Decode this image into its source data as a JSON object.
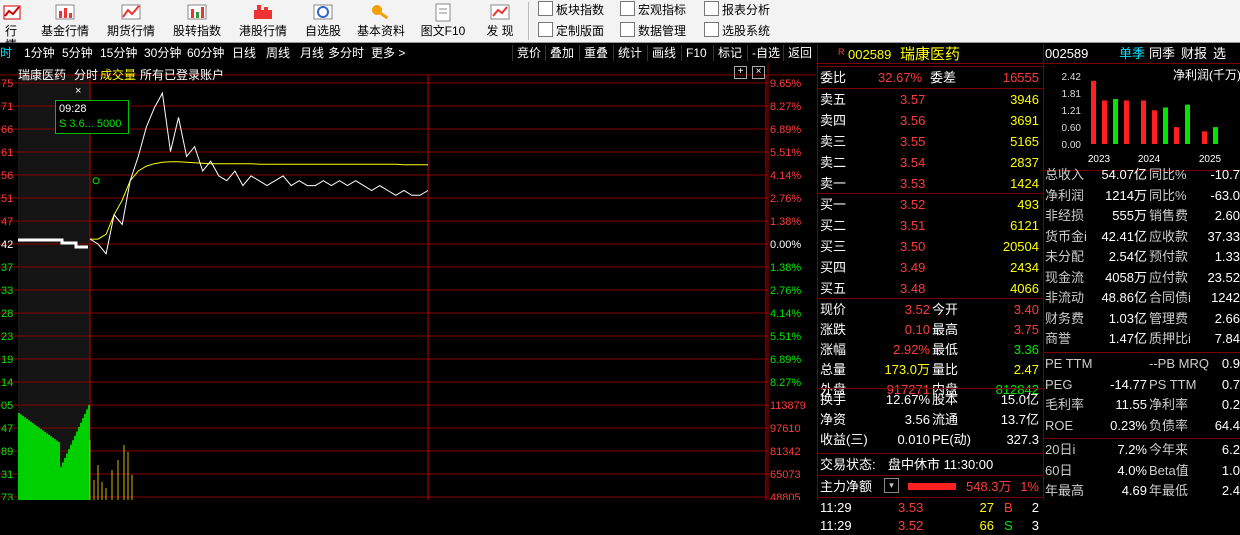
{
  "toolbar": {
    "buttons": [
      {
        "label": "行情",
        "icon": "quote-icon"
      },
      {
        "label": "基金行情",
        "icon": "fund-icon"
      },
      {
        "label": "期货行情",
        "icon": "futures-icon"
      },
      {
        "label": "股转指数",
        "icon": "index-icon"
      },
      {
        "label": "港股行情",
        "icon": "hk-stock-icon"
      },
      {
        "label": "自选股",
        "icon": "watchlist-icon"
      },
      {
        "label": "基本资料",
        "icon": "key-icon"
      },
      {
        "label": "图文F10",
        "icon": "document-icon"
      },
      {
        "label": "发 现",
        "icon": "discover-icon"
      }
    ],
    "small_buttons": [
      "板块指数",
      "宏观指标",
      "报表分析",
      "定制版面",
      "数据管理",
      "选股系统"
    ]
  },
  "periods": {
    "items": [
      "时",
      "1分钟",
      "5分钟",
      "15分钟",
      "30分钟",
      "60分钟",
      "日线",
      "周线",
      "月线",
      "多分时",
      "更多 >"
    ],
    "right_items": [
      "竞价",
      "叠加",
      "重叠",
      "统计",
      "画线",
      "F10",
      "标记",
      "-自选",
      "返回"
    ]
  },
  "chart": {
    "header_name": "瑞康医药",
    "header_mode": "分时",
    "header_volume": "成交量",
    "header_account": "所有已登录账户",
    "tooltip_time": "09:28",
    "tooltip_value": "S 3.6... 5000",
    "left_ticks": [
      "75",
      "71",
      "66",
      "61",
      "56",
      "51",
      "47",
      "42",
      "37",
      "33",
      "28",
      "23",
      "19",
      "14",
      "05",
      "47",
      "89",
      "31",
      "73"
    ],
    "pct_ticks": [
      "9.65%",
      "8.27%",
      "6.89%",
      "5.51%",
      "4.14%",
      "2.76%",
      "1.38%",
      "0.00%",
      "1.38%",
      "2.76%",
      "4.14%",
      "5.51%",
      "6.89%",
      "8.27%"
    ],
    "vol_ticks": [
      "113879",
      "97610",
      "81342",
      "65073",
      "48805"
    ],
    "price_series": [
      3.43,
      3.42,
      3.4,
      3.48,
      3.46,
      3.55,
      3.6,
      3.66,
      3.7,
      3.73,
      3.61,
      3.68,
      3.6,
      3.62,
      3.57,
      3.59,
      3.56,
      3.55,
      3.57,
      3.54,
      3.56,
      3.55,
      3.54,
      3.55,
      3.56,
      3.54,
      3.55,
      3.54,
      3.54,
      3.55,
      3.54,
      3.55,
      3.54,
      3.55,
      3.54,
      3.53,
      3.54,
      3.53,
      3.52,
      3.53,
      3.52,
      3.52,
      3.53
    ],
    "avg_series": [
      3.43,
      3.43,
      3.44,
      3.48,
      3.51,
      3.55,
      3.57,
      3.58,
      3.585,
      3.588,
      3.589,
      3.589,
      3.588,
      3.587,
      3.586,
      3.585,
      3.585,
      3.585,
      3.585,
      3.585,
      3.585,
      3.584,
      3.584,
      3.584,
      3.584,
      3.584,
      3.584,
      3.584,
      3.584,
      3.584,
      3.584,
      3.584,
      3.584,
      3.584,
      3.584,
      3.584,
      3.584,
      3.584,
      3.584,
      3.583,
      3.583,
      3.583,
      3.583
    ]
  },
  "quote": {
    "code_badge": "R",
    "code": "002589",
    "name": "瑞康医药",
    "ratio_label": "委比",
    "ratio_value": "32.67%",
    "diff_label": "委差",
    "diff_value": "16555",
    "asks": [
      {
        "label": "卖五",
        "price": "3.57",
        "vol": "3946"
      },
      {
        "label": "卖四",
        "price": "3.56",
        "vol": "3691"
      },
      {
        "label": "卖三",
        "price": "3.55",
        "vol": "5165"
      },
      {
        "label": "卖二",
        "price": "3.54",
        "vol": "2837"
      },
      {
        "label": "卖一",
        "price": "3.53",
        "vol": "1424"
      }
    ],
    "bids": [
      {
        "label": "买一",
        "price": "3.52",
        "vol": "493"
      },
      {
        "label": "买二",
        "price": "3.51",
        "vol": "6121"
      },
      {
        "label": "买三",
        "price": "3.50",
        "vol": "20504"
      },
      {
        "label": "买四",
        "price": "3.49",
        "vol": "2434"
      },
      {
        "label": "买五",
        "price": "3.48",
        "vol": "4066"
      }
    ],
    "stats": [
      {
        "l1": "现价",
        "v1": "3.52",
        "l2": "今开",
        "v2": "3.40"
      },
      {
        "l1": "涨跌",
        "v1": "0.10",
        "l2": "最高",
        "v2": "3.75"
      },
      {
        "l1": "涨幅",
        "v1": "2.92%",
        "l2": "最低",
        "v2": "3.36"
      },
      {
        "l1": "总量",
        "v1": "173.0万",
        "l2": "量比",
        "v2": "2.47"
      },
      {
        "l1": "外盘",
        "v1": "917271",
        "l2": "内盘",
        "v2": "812842"
      }
    ],
    "stats2": [
      {
        "l1": "换手",
        "v1": "12.67%",
        "l2": "股本",
        "v2": "15.0亿"
      },
      {
        "l1": "净资",
        "v1": "3.56",
        "l2": "流通",
        "v2": "13.7亿"
      },
      {
        "l1": "收益(三)",
        "v1": "0.010",
        "l2": "PE(动)",
        "v2": "327.3"
      }
    ],
    "trade_status_label": "交易状态:",
    "trade_status": "盘中休市 11:30:00",
    "main_flow_label": "主力净额",
    "main_flow_value": "548.3万",
    "main_flow_pct": "1%",
    "ticks": [
      {
        "time": "11:29",
        "price": "3.53",
        "vol": "27",
        "side": "B",
        "n": "2"
      },
      {
        "time": "11:29",
        "price": "3.52",
        "vol": "66",
        "side": "S",
        "n": "3"
      }
    ]
  },
  "fin": {
    "code": "002589",
    "tabs": [
      "单季",
      "同季",
      "财报",
      "选"
    ],
    "chart_title": "净利润(千万)",
    "y_ticks": [
      "2.42",
      "1.81",
      "1.21",
      "0.60",
      "0.00"
    ],
    "years": [
      "2023",
      "2024",
      "2025"
    ],
    "rows": [
      {
        "l1": "总收入",
        "v1": "54.07亿",
        "l2": "同比%",
        "v2": "-10.7"
      },
      {
        "l1": "净利润",
        "v1": "1214万",
        "l2": "同比%",
        "v2": "-63.0"
      },
      {
        "l1": "非经损",
        "v1": "555万",
        "l2": "销售费",
        "v2": "2.60"
      },
      {
        "l1": "货币金i",
        "v1": "42.41亿",
        "l2": "应收款",
        "v2": "37.33"
      },
      {
        "l1": "未分配",
        "v1": "2.54亿",
        "l2": "预付款",
        "v2": "1.33"
      },
      {
        "l1": "现金流",
        "v1": "4058万",
        "l2": "应付款",
        "v2": "23.52"
      },
      {
        "l1": "非流动",
        "v1": "48.86亿",
        "l2": "合同债i",
        "v2": "1242"
      },
      {
        "l1": "财务费",
        "v1": "1.03亿",
        "l2": "管理费",
        "v2": "2.66"
      },
      {
        "l1": "商誉",
        "v1": "1.47亿",
        "l2": "质押比i",
        "v2": "7.84"
      }
    ],
    "rows2": [
      {
        "l1": "PE TTM",
        "v1": "",
        "l2": "--PB MRQ",
        "v2": "0.9"
      },
      {
        "l1": "PEG",
        "v1": "-14.77",
        "l2": "PS TTM",
        "v2": "0.7"
      },
      {
        "l1": "毛利率",
        "v1": "11.55",
        "l2": "净利率",
        "v2": "0.2"
      },
      {
        "l1": "ROE",
        "v1": "0.23%",
        "l2": "负债率",
        "v2": "64.4"
      }
    ],
    "rows3": [
      {
        "l1": "20日i",
        "v1": "7.2%",
        "l2": "今年来",
        "v2": "6.2"
      },
      {
        "l1": "60日",
        "v1": "4.0%",
        "l2": "Beta值",
        "v2": "1.0"
      },
      {
        "l1": "年最高",
        "v1": "4.69",
        "l2": "年最低",
        "v2": "2.4"
      }
    ],
    "bars": [
      {
        "year": "2023",
        "series": [
          {
            "color": "#ff2020",
            "v": 2.25
          },
          {
            "color": "#ff2020",
            "v": 1.55
          },
          {
            "color": "#00e600",
            "v": 1.6
          },
          {
            "color": "#ff2020",
            "v": 1.55
          }
        ]
      },
      {
        "year": "2024",
        "series": [
          {
            "color": "#ff2020",
            "v": 1.55
          },
          {
            "color": "#ff2020",
            "v": 1.2
          },
          {
            "color": "#00e600",
            "v": 1.3
          },
          {
            "color": "#ff2020",
            "v": 0.6
          },
          {
            "color": "#00e600",
            "v": 1.4
          }
        ]
      },
      {
        "year": "2025",
        "series": [
          {
            "color": "#ff2020",
            "v": 0.45
          },
          {
            "color": "#00e600",
            "v": 0.6
          }
        ]
      }
    ]
  }
}
